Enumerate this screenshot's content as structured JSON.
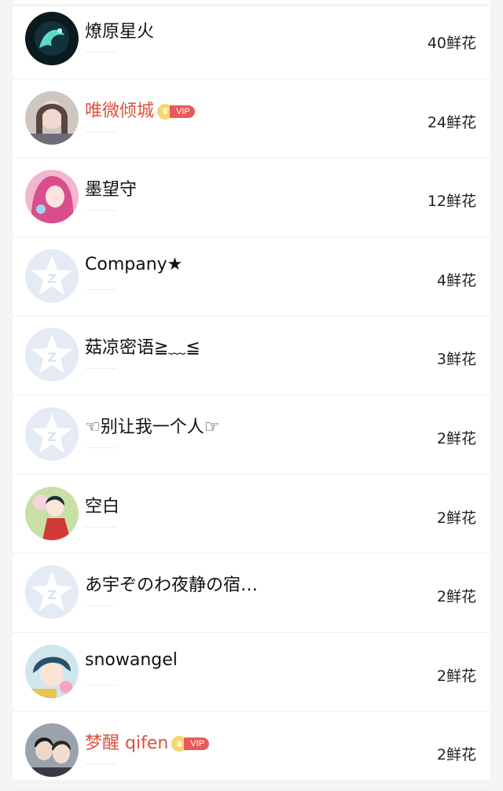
{
  "flower_list": {
    "rows": [
      {
        "name": "燎原星火",
        "count": "40鲜花",
        "vip": false,
        "avatar": "dragon-avatar-icon"
      },
      {
        "name": "唯微倾城",
        "count": "24鲜花",
        "vip": true,
        "vip_label": "VIP",
        "avatar": "girl-photo-avatar-icon"
      },
      {
        "name": "墨望守",
        "count": "12鲜花",
        "vip": false,
        "avatar": "anime-girl-avatar-icon"
      },
      {
        "name": "Company★",
        "count": "4鲜花",
        "vip": false,
        "avatar": "default-star-avatar-icon"
      },
      {
        "name": "菇凉密语≧﹏≦",
        "count": "3鲜花",
        "vip": false,
        "avatar": "default-star-avatar-icon"
      },
      {
        "name": "☜别让我一个人☞",
        "count": "2鲜花",
        "vip": false,
        "avatar": "default-star-avatar-icon"
      },
      {
        "name": "空白",
        "count": "2鲜花",
        "vip": false,
        "avatar": "anime-red-avatar-icon"
      },
      {
        "name": "あ宇ぞのわ夜静の宿…",
        "count": "2鲜花",
        "vip": false,
        "avatar": "default-star-avatar-icon"
      },
      {
        "name": "snowangel",
        "count": "2鲜花",
        "vip": false,
        "avatar": "anime-boy-avatar-icon"
      },
      {
        "name": "梦醒 qifen",
        "count": "2鲜花",
        "vip": true,
        "vip_label": "VIP",
        "avatar": "couple-photo-avatar-icon"
      }
    ]
  },
  "colors": {
    "vip_name": "#e0503c",
    "default_avatar": "#e4ebf5"
  }
}
